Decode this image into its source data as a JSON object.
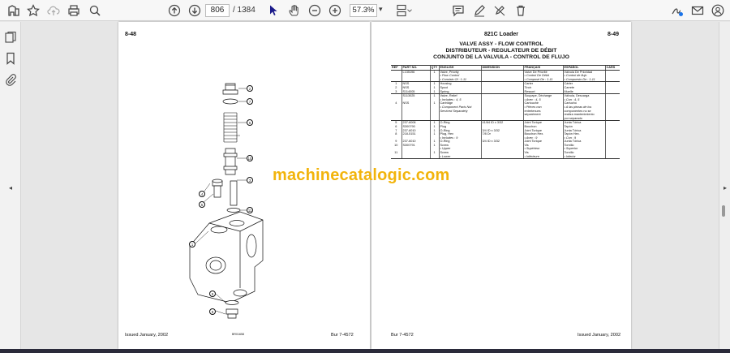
{
  "toolbar": {
    "current_page": "806",
    "total_pages": "/ 1384",
    "zoom": "57.3%",
    "zoom_dropdown": "▾"
  },
  "left_page": {
    "page_number": "8-48",
    "footer_left": "Issued January, 2002",
    "footer_right": "Bur 7-4572",
    "figure_id": "BR01658",
    "callouts": [
      "2",
      "7",
      "6",
      "10",
      "3",
      "4",
      "5",
      "11",
      "1",
      "9",
      "8"
    ]
  },
  "right_page": {
    "model": "821C Loader",
    "page_number": "8-49",
    "title_en": "VALVE ASSY - FLOW CONTROL",
    "title_fr": "DISTRIBUTEUR - REGULATEUR DE DÉBIT",
    "title_es": "CONJUNTO DE LA VALVULA - CONTROL DE FLUJO",
    "footer_left": "Bur 7-4572",
    "footer_right": "Issued January, 2002",
    "columns": [
      "REF",
      "PART NO.",
      "QTY",
      "ENGLISH",
      "DIMENSION",
      "FRANÇAIS",
      "ESPAÑOL",
      "CARS"
    ],
    "rows": [
      {
        "ref": "",
        "part": "L135196",
        "qty": "1",
        "en": "Valve, Priority",
        "dim": "",
        "fr": "Valve De Priorité",
        "es": "Válvula De Prioridad",
        "sep": false
      },
      {
        "ref": "",
        "part": "",
        "qty": "",
        "en": "• Flow Control",
        "dim": "",
        "fr": "• Control De Débit",
        "es": "• Control de flujo",
        "sep": false
      },
      {
        "ref": "",
        "part": "",
        "qty": "",
        "en": "• Consists Of : 1-11",
        "dim": "",
        "fr": "• Composé De : 1-11",
        "es": "• Compuesto De : 1-11",
        "sep": true
      },
      {
        "ref": "1",
        "part": "NSS",
        "qty": "1",
        "en": "Housing",
        "dim": "",
        "fr": "Carter",
        "es": "Cárter",
        "sep": false
      },
      {
        "ref": "2",
        "part": "NSS",
        "qty": "1",
        "en": "Spool",
        "dim": "",
        "fr": "Tiroir",
        "es": "Carrete",
        "sep": false
      },
      {
        "ref": "3",
        "part": "S114005",
        "qty": "1",
        "en": "Spring",
        "dim": "",
        "fr": "Ressort",
        "es": "Muelle",
        "sep": true
      },
      {
        "ref": "",
        "part": "S113025",
        "qty": "1",
        "en": "Valve, Relief",
        "dim": "",
        "fr": "Soupape, Décharge",
        "es": "Válvula, Descarga",
        "sep": false
      },
      {
        "ref": "",
        "part": "",
        "qty": "",
        "en": "• Includes : 4, 5",
        "dim": "",
        "fr": "• Avec : 4, 5",
        "es": "• Con : 4, 5",
        "sep": false
      },
      {
        "ref": "4",
        "part": "NSS",
        "qty": "1",
        "en": "Cartridge",
        "dim": "",
        "fr": "Cartouche",
        "es": "Cartucho",
        "sep": false
      },
      {
        "ref": "",
        "part": "",
        "qty": "",
        "en": "• Component Parts Not",
        "dim": "",
        "fr": "• Pièces non",
        "es": "• A las piezas de los",
        "sep": false
      },
      {
        "ref": "",
        "part": "",
        "qty": "",
        "en": "Serviced Separately",
        "dim": "",
        "fr": "entretenues",
        "es": "componentes no se",
        "sep": false
      },
      {
        "ref": "",
        "part": "",
        "qty": "",
        "en": "",
        "dim": "",
        "fr": "séparément",
        "es": "realiza mantenimiento",
        "sep": false
      },
      {
        "ref": "",
        "part": "",
        "qty": "",
        "en": "",
        "dim": "",
        "fr": "",
        "es": "por separado",
        "sep": true
      },
      {
        "ref": "5",
        "part": "237-6006",
        "qty": "1",
        "en": "O-Ring",
        "dim": "41/64 ID x 3/32",
        "fr": "Joint Torique",
        "es": "Junta Tórica",
        "sep": false
      },
      {
        "ref": "6",
        "part": "S300790",
        "qty": "1",
        "en": "Plug",
        "dim": "",
        "fr": "Bouchon",
        "es": "Tapón",
        "sep": false
      },
      {
        "ref": "7",
        "part": "237-6010",
        "qty": "1",
        "en": "O-Ring",
        "dim": "3/4 ID x 3/32",
        "fr": "Joint Torique",
        "es": "Junta Tórica",
        "sep": false
      },
      {
        "ref": "8",
        "part": "218-5151",
        "qty": "1",
        "en": "Plug, Hex",
        "dim": "7/8 Dr",
        "fr": "Bouchon Hex.",
        "es": "Tapón Hex.",
        "sep": false
      },
      {
        "ref": "",
        "part": "",
        "qty": "",
        "en": "• Includes : 9",
        "dim": "",
        "fr": "• Avec : 9",
        "es": "• Con : 9",
        "sep": false
      },
      {
        "ref": "9",
        "part": "237-6010",
        "qty": "1",
        "en": "O-Ring",
        "dim": "3/4 ID x 3/32",
        "fr": "Joint Torique",
        "es": "Junta Tórica",
        "sep": false
      },
      {
        "ref": "10",
        "part": "S300791",
        "qty": "1",
        "en": "Screw",
        "dim": "",
        "fr": "Vis",
        "es": "Tornillo",
        "sep": false
      },
      {
        "ref": "",
        "part": "",
        "qty": "",
        "en": "• Upper",
        "dim": "",
        "fr": "• Supérieur",
        "es": "• Superior",
        "sep": false
      },
      {
        "ref": "11",
        "part": "",
        "qty": "1",
        "en": "Screw",
        "dim": "",
        "fr": "Vis",
        "es": "Tornillo",
        "sep": false
      },
      {
        "ref": "",
        "part": "",
        "qty": "",
        "en": "• Lower",
        "dim": "",
        "fr": "• Inférieure",
        "es": "• Inferior",
        "sep": true
      }
    ]
  },
  "watermark": "machinecatalogic.com",
  "colors": {
    "watermark": "#f2b40c",
    "toolbar_bg": "#f7f7f7",
    "viewer_bg": "#e6e6e6"
  }
}
